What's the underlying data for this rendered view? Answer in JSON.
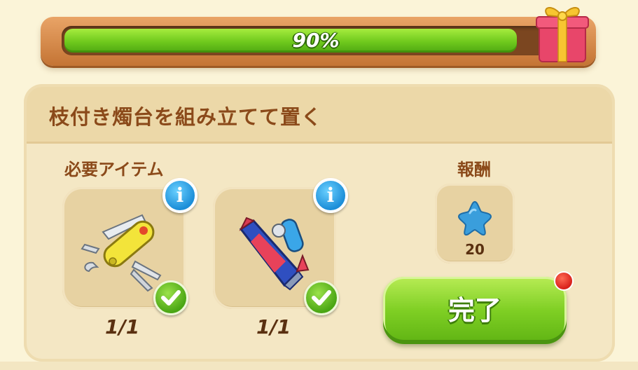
{
  "progress": {
    "percent": 90,
    "label": "90%"
  },
  "quest": {
    "title": "枝付き燭台を組み立てて置く"
  },
  "required_items": {
    "label": "必要アイテム",
    "items": [
      {
        "name": "pocket-knife",
        "count": "1/1"
      },
      {
        "name": "paint-tube-and-roller",
        "count": "1/1"
      }
    ]
  },
  "reward": {
    "label": "報酬",
    "amount": "20",
    "icon": "blue-star-icon"
  },
  "complete_button": {
    "label": "完了"
  },
  "colors": {
    "accent_green": "#7fcf24",
    "title_brown": "#8b4a1a",
    "info_blue": "#1c8ed8",
    "notification_red": "#d8201a"
  }
}
